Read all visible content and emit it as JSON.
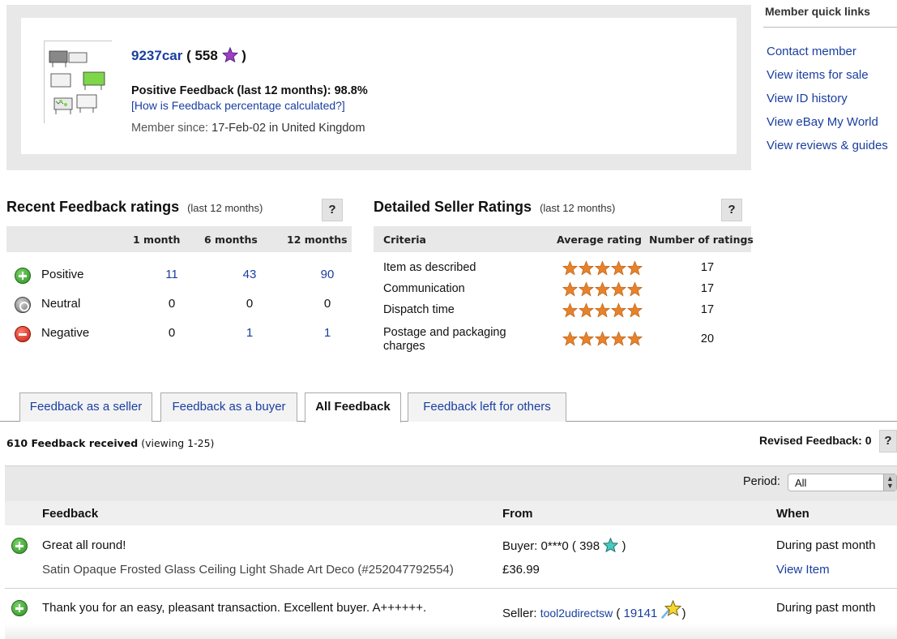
{
  "member": {
    "username": "9237car",
    "score": "558",
    "positive_label": "Positive Feedback (last 12 months): 98.8%",
    "how_link": "[How is Feedback percentage calculated?]",
    "since_label": "Member since:",
    "since_value": "17-Feb-02 in United Kingdom",
    "star_color": "#9b3fc4"
  },
  "quick_links": {
    "title": "Member quick links",
    "items": [
      "Contact member",
      "View items for sale",
      "View ID history",
      "View eBay My World",
      "View reviews & guides"
    ]
  },
  "recent": {
    "title": "Recent Feedback ratings",
    "subtitle": "(last 12 months)",
    "help": "?",
    "columns": [
      "1 month",
      "6 months",
      "12 months"
    ],
    "rows": [
      {
        "label": "Positive",
        "values": [
          "11",
          "43",
          "90"
        ],
        "links": [
          true,
          true,
          true
        ]
      },
      {
        "label": "Neutral",
        "values": [
          "0",
          "0",
          "0"
        ],
        "links": [
          false,
          false,
          false
        ]
      },
      {
        "label": "Negative",
        "values": [
          "0",
          "1",
          "1"
        ],
        "links": [
          false,
          true,
          true
        ]
      }
    ]
  },
  "dsr": {
    "title": "Detailed Seller Ratings",
    "subtitle": "(last 12 months)",
    "help": "?",
    "columns": [
      "Criteria",
      "Average rating",
      "Number of ratings"
    ],
    "rows": [
      {
        "criteria": "Item as described",
        "stars": 5,
        "count": "17"
      },
      {
        "criteria": "Communication",
        "stars": 5,
        "count": "17"
      },
      {
        "criteria": "Dispatch time",
        "stars": 5,
        "count": "17"
      },
      {
        "criteria": "Postage and packaging charges",
        "stars": 5,
        "count": "20"
      }
    ],
    "star_color": "#e8822a"
  },
  "tabs": [
    "Feedback as a seller",
    "Feedback as a buyer",
    "All Feedback",
    "Feedback left for others"
  ],
  "active_tab": "All Feedback",
  "received": {
    "count_label": "610 Feedback received",
    "viewing": "(viewing 1-25)"
  },
  "revised": {
    "label": "Revised Feedback: 0",
    "help": "?"
  },
  "period": {
    "label": "Period:",
    "value": "All"
  },
  "feedback_table": {
    "columns": [
      "Feedback",
      "From",
      "When"
    ],
    "entries": [
      {
        "comment": "Great all round!",
        "item": "Satin Opaque Frosted Glass Ceiling Light Shade Art Deco (#252047792554)",
        "from_role": "Buyer:",
        "from_user": "0***0",
        "from_score": "398",
        "price": "£36.99",
        "when": "During past month",
        "action": "View Item"
      },
      {
        "comment": "Thank you for an easy, pleasant transaction. Excellent buyer. A++++++.",
        "item": "--",
        "from_role": "Seller:",
        "from_user": "tool2udirectsw",
        "from_score": "19141",
        "price": "--",
        "when": "During past month"
      }
    ]
  }
}
